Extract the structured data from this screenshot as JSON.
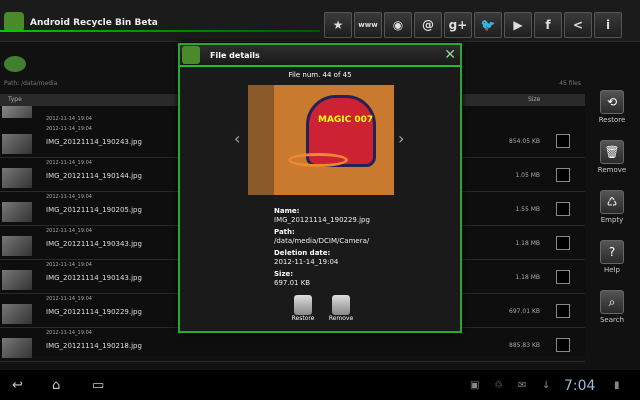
{
  "app": {
    "title": "Android Recycle Bin Beta"
  },
  "top_icons": [
    {
      "icon": "star-icon",
      "glyph": "★"
    },
    {
      "icon": "www-icon",
      "glyph": "www"
    },
    {
      "icon": "rss-icon",
      "glyph": "◉"
    },
    {
      "icon": "email-icon",
      "glyph": "@"
    },
    {
      "icon": "google-plus-icon",
      "glyph": "g+"
    },
    {
      "icon": "twitter-icon",
      "glyph": "🐦"
    },
    {
      "icon": "youtube-icon",
      "glyph": "▶"
    },
    {
      "icon": "facebook-icon",
      "glyph": "f"
    },
    {
      "icon": "share-icon",
      "glyph": "<"
    },
    {
      "icon": "info-icon",
      "glyph": "i"
    }
  ],
  "path": {
    "text": "Path: /data/media",
    "count": "45 files"
  },
  "columns": {
    "type": "Type",
    "size": "Size"
  },
  "first_row_date": "2012-11-14_19:04",
  "files": [
    {
      "date": "2012-11-14_19:04",
      "name": "IMG_20121114_190243.jpg",
      "size": "854.05 KB"
    },
    {
      "date": "2012-11-14_19:04",
      "name": "IMG_20121114_190144.jpg",
      "size": "1.05 MB"
    },
    {
      "date": "2012-11-14_19:04",
      "name": "IMG_20121114_190205.jpg",
      "size": "1.55 MB"
    },
    {
      "date": "2012-11-14_19:04",
      "name": "IMG_20121114_190343.jpg",
      "size": "1.18 MB"
    },
    {
      "date": "2012-11-14_19:04",
      "name": "IMG_20121114_190143.jpg",
      "size": "1.18 MB"
    },
    {
      "date": "2012-11-14_19:04",
      "name": "IMG_20121114_190229.jpg",
      "size": "697.01 KB"
    },
    {
      "date": "2012-11-14_19:04",
      "name": "IMG_20121114_190218.jpg",
      "size": "885.83 KB"
    }
  ],
  "sidebar": [
    {
      "label": "Restore",
      "glyph": "⟲"
    },
    {
      "label": "Remove",
      "glyph": "🗑"
    },
    {
      "label": "Empty",
      "glyph": "♺"
    },
    {
      "label": "Help",
      "glyph": "?"
    },
    {
      "label": "Search",
      "glyph": "⌕"
    }
  ],
  "dialog": {
    "title": "File details",
    "file_num": "File num. 44 of 45",
    "photo_text": "MAGIC 007",
    "name_label": "Name:",
    "name": "IMG_20121114_190229.jpg",
    "path_label": "Path:",
    "path": "/data/media/DCIM/Camera/",
    "date_label": "Deletion date:",
    "date": "2012-11-14_19:04",
    "size_label": "Size:",
    "size": "697.01 KB",
    "restore": "Restore",
    "remove": "Remove"
  },
  "clock": "7:04"
}
